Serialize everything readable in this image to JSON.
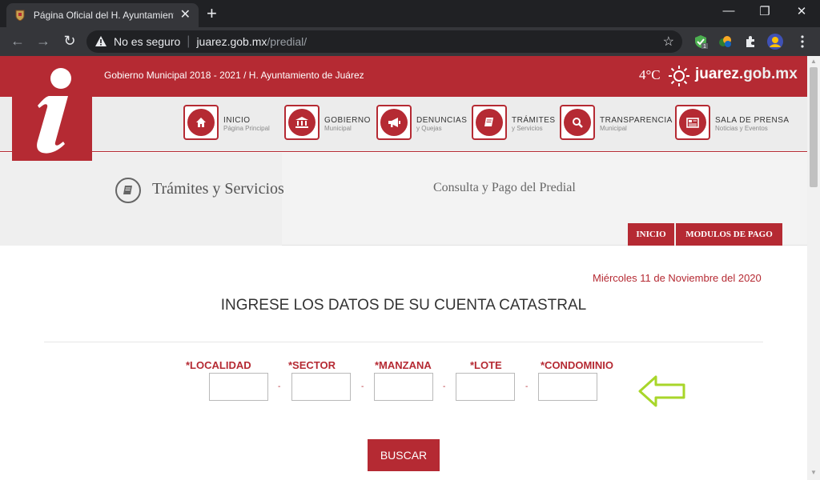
{
  "browser": {
    "tab_title": "Página Oficial del H. Ayuntamiento",
    "address_security": "No es seguro",
    "address_host": "juarez.gob.mx",
    "address_path": "/predial/",
    "extension_badge": "1"
  },
  "header": {
    "top_text": "Gobierno Municipal 2018 - 2021 / H. Ayuntamiento de Juárez",
    "temperature": "4°C",
    "brand_name": "juarez",
    "brand_tld": ".gob.mx",
    "accent_color": "#b52a33"
  },
  "nav": [
    {
      "label": "INICIO",
      "sub": "Página Principal",
      "icon": "home-icon"
    },
    {
      "label": "GOBIERNO",
      "sub": "Municipal",
      "icon": "government-building-icon"
    },
    {
      "label": "DENUNCIAS",
      "sub": "y Quejas",
      "icon": "megaphone-icon"
    },
    {
      "label": "TRÁMITES",
      "sub": "y Servicios",
      "icon": "book-icon"
    },
    {
      "label": "TRANSPARENCIA",
      "sub": "Municipal",
      "icon": "search-icon"
    },
    {
      "label": "SALA DE PRENSA",
      "sub": "Noticias y Eventos",
      "icon": "newspaper-icon"
    }
  ],
  "section": {
    "title": "Trámites y Servicios",
    "subtitle": "Consulta y Pago del Predial",
    "btn_inicio": "INICIO",
    "btn_modulos": "MODULOS DE PAGO"
  },
  "form": {
    "date": "Miércoles 11 de Noviembre del 2020",
    "heading": "INGRESE LOS DATOS DE SU CUENTA CATASTRAL",
    "fields": [
      {
        "label": "*LOCALIDAD",
        "value": ""
      },
      {
        "label": "*SECTOR",
        "value": ""
      },
      {
        "label": "*MANZANA",
        "value": ""
      },
      {
        "label": "*LOTE",
        "value": ""
      },
      {
        "label": "*CONDOMINIO",
        "value": ""
      }
    ],
    "separator": "-",
    "submit": "BUSCAR"
  }
}
